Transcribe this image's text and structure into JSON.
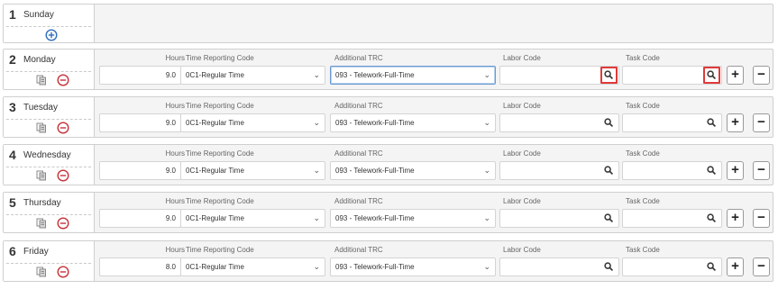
{
  "labels": {
    "hours": "Hours",
    "trc": "Time Reporting Code",
    "additional_trc": "Additional TRC",
    "labor_code": "Labor Code",
    "task_code": "Task Code"
  },
  "sunday": {
    "num": "1",
    "name": "Sunday"
  },
  "days": [
    {
      "num": "2",
      "name": "Monday",
      "hours": "9.0",
      "trc": "0C1-Regular Time",
      "additional_trc": "093 - Telework-Full-Time",
      "labor_code": "",
      "task_code": ""
    },
    {
      "num": "3",
      "name": "Tuesday",
      "hours": "9.0",
      "trc": "0C1-Regular Time",
      "additional_trc": "093 - Telework-Full-Time",
      "labor_code": "",
      "task_code": ""
    },
    {
      "num": "4",
      "name": "Wednesday",
      "hours": "9.0",
      "trc": "0C1-Regular Time",
      "additional_trc": "093 - Telework-Full-Time",
      "labor_code": "",
      "task_code": ""
    },
    {
      "num": "5",
      "name": "Thursday",
      "hours": "9.0",
      "trc": "0C1-Regular Time",
      "additional_trc": "093 - Telework-Full-Time",
      "labor_code": "",
      "task_code": ""
    },
    {
      "num": "6",
      "name": "Friday",
      "hours": "8.0",
      "trc": "0C1-Regular Time",
      "additional_trc": "093 - Telework-Full-Time",
      "labor_code": "",
      "task_code": ""
    }
  ],
  "buttons": {
    "plus": "+",
    "minus": "−"
  },
  "colors": {
    "highlight": "#e03a3a",
    "remove_icon": "#c8313a",
    "add_icon": "#2f6ebd"
  }
}
